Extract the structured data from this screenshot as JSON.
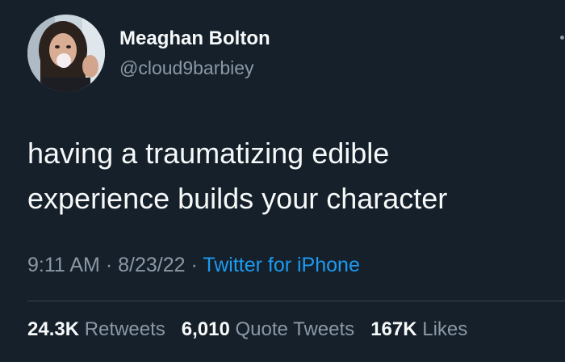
{
  "author": {
    "name": "Meaghan Bolton",
    "handle": "@cloud9barbiey"
  },
  "tweet": {
    "text_lines": [
      "having a traumatizing edible",
      "experience builds your character"
    ],
    "time": "9:11 AM",
    "date": "8/23/22",
    "separator": "·",
    "source": "Twitter for iPhone"
  },
  "stats": {
    "retweets": {
      "count": "24.3K",
      "label": "Retweets"
    },
    "quote_tweets": {
      "count": "6,010",
      "label": "Quote Tweets"
    },
    "likes": {
      "count": "167K",
      "label": "Likes"
    }
  },
  "icons": {
    "more": "more-horizontal-icon"
  },
  "colors": {
    "background": "#15202b",
    "primary_text": "#f7f9f9",
    "secondary_text": "#8b98a5",
    "accent": "#1d9bf0",
    "divider": "#38444d"
  }
}
